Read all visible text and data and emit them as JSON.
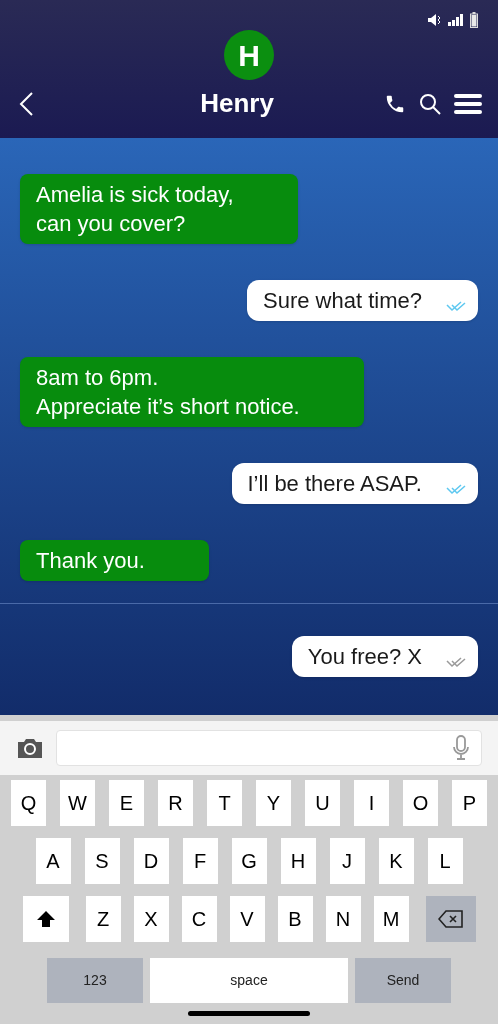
{
  "header": {
    "avatar_letter": "H",
    "contact_name": "Henry"
  },
  "messages": [
    {
      "kind": "incoming",
      "text": "Amelia is sick today,\ncan you cover?"
    },
    {
      "kind": "outgoing",
      "text": "Sure what time?",
      "read": true
    },
    {
      "kind": "incoming",
      "text": "8am to 6pm.\nAppreciate it’s short notice."
    },
    {
      "kind": "outgoing",
      "text": "I’ll be there ASAP.",
      "read": true
    },
    {
      "kind": "incoming",
      "text": "Thank you."
    },
    {
      "kind": "divider"
    },
    {
      "kind": "outgoing",
      "text": "You free? X",
      "read": false
    }
  ],
  "keyboard": {
    "letter_rows": [
      {
        "keys": [
          {
            "kind": "letter",
            "label": "Q"
          },
          {
            "kind": "letter",
            "label": "W"
          },
          {
            "kind": "letter",
            "label": "E"
          },
          {
            "kind": "letter",
            "label": "R"
          },
          {
            "kind": "letter",
            "label": "T"
          },
          {
            "kind": "letter",
            "label": "Y"
          },
          {
            "kind": "letter",
            "label": "U"
          },
          {
            "kind": "letter",
            "label": "I"
          },
          {
            "kind": "letter",
            "label": "O"
          },
          {
            "kind": "letter",
            "label": "P"
          }
        ]
      },
      {
        "keys": [
          {
            "kind": "letter",
            "label": "A"
          },
          {
            "kind": "letter",
            "label": "S"
          },
          {
            "kind": "letter",
            "label": "D"
          },
          {
            "kind": "letter",
            "label": "F"
          },
          {
            "kind": "letter",
            "label": "G"
          },
          {
            "kind": "letter",
            "label": "H"
          },
          {
            "kind": "letter",
            "label": "J"
          },
          {
            "kind": "letter",
            "label": "K"
          },
          {
            "kind": "letter",
            "label": "L"
          }
        ]
      },
      {
        "keys": [
          {
            "kind": "shift"
          },
          {
            "kind": "letter",
            "label": "Z"
          },
          {
            "kind": "letter",
            "label": "X"
          },
          {
            "kind": "letter",
            "label": "C"
          },
          {
            "kind": "letter",
            "label": "V"
          },
          {
            "kind": "letter",
            "label": "B"
          },
          {
            "kind": "letter",
            "label": "N"
          },
          {
            "kind": "letter",
            "label": "M"
          },
          {
            "kind": "backspace"
          }
        ]
      }
    ],
    "bottom_keys": [
      {
        "kind": "function",
        "label": "123"
      },
      {
        "kind": "space",
        "label": "space"
      },
      {
        "kind": "function",
        "label": "Send"
      }
    ]
  }
}
